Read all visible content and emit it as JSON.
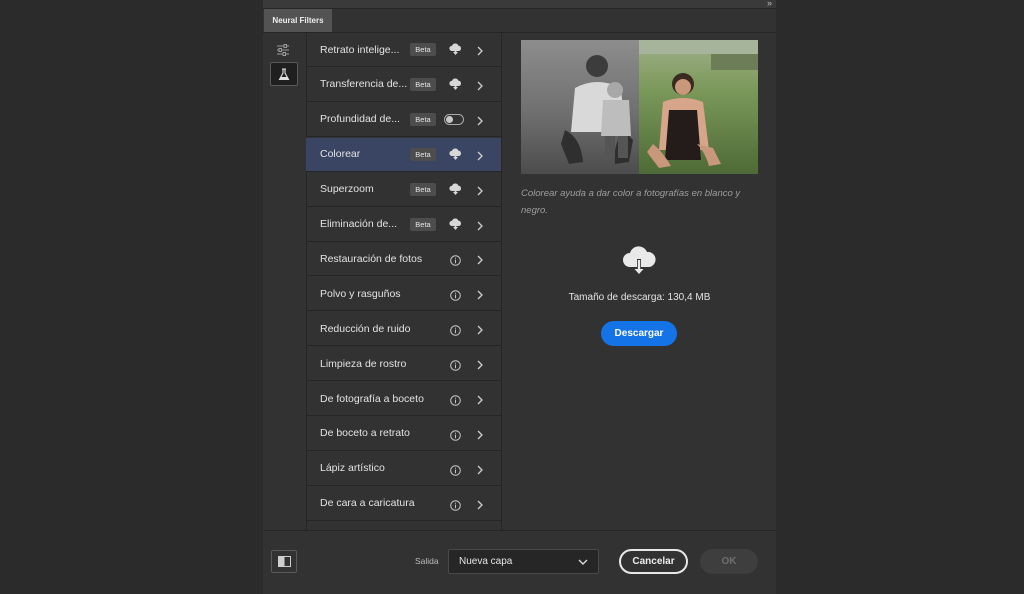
{
  "panel": {
    "tab_title": "Neural Filters",
    "collapse_glyph": "»"
  },
  "tools": [
    {
      "icon": "sliders-icon",
      "active": false
    },
    {
      "icon": "flask-icon",
      "active": true
    }
  ],
  "filters": [
    {
      "label": "Retrato intelige...",
      "beta": "Beta",
      "status": "cloud-download"
    },
    {
      "label": "Transferencia de...",
      "beta": "Beta",
      "status": "cloud-download"
    },
    {
      "label": "Profundidad de...",
      "beta": "Beta",
      "status": "toggle-off"
    },
    {
      "label": "Colorear",
      "beta": "Beta",
      "status": "cloud-download",
      "selected": true
    },
    {
      "label": "Superzoom",
      "beta": "Beta",
      "status": "cloud-download"
    },
    {
      "label": "Eliminación de...",
      "beta": "Beta",
      "status": "cloud-download"
    },
    {
      "label": "Restauración de fotos",
      "status": "info"
    },
    {
      "label": "Polvo y rasguños",
      "status": "info"
    },
    {
      "label": "Reducción de ruido",
      "status": "info"
    },
    {
      "label": "Limpieza de rostro",
      "status": "info"
    },
    {
      "label": "De fotografía a boceto",
      "status": "info"
    },
    {
      "label": "De boceto a retrato",
      "status": "info"
    },
    {
      "label": "Lápiz artístico",
      "status": "info"
    },
    {
      "label": "De cara a caricatura",
      "status": "info"
    }
  ],
  "detail": {
    "description": "Colorear ayuda a dar color a fotografías en blanco y negro.",
    "download_size": "Tamaño de descarga: 130,4 MB",
    "download_button": "Descargar"
  },
  "footer": {
    "output_label": "Salida",
    "output_value": "Nueva capa",
    "cancel": "Cancelar",
    "ok": "OK"
  },
  "colors": {
    "accent": "#1473e6",
    "selected_row": "#3a4564",
    "panel_bg": "#323232"
  }
}
